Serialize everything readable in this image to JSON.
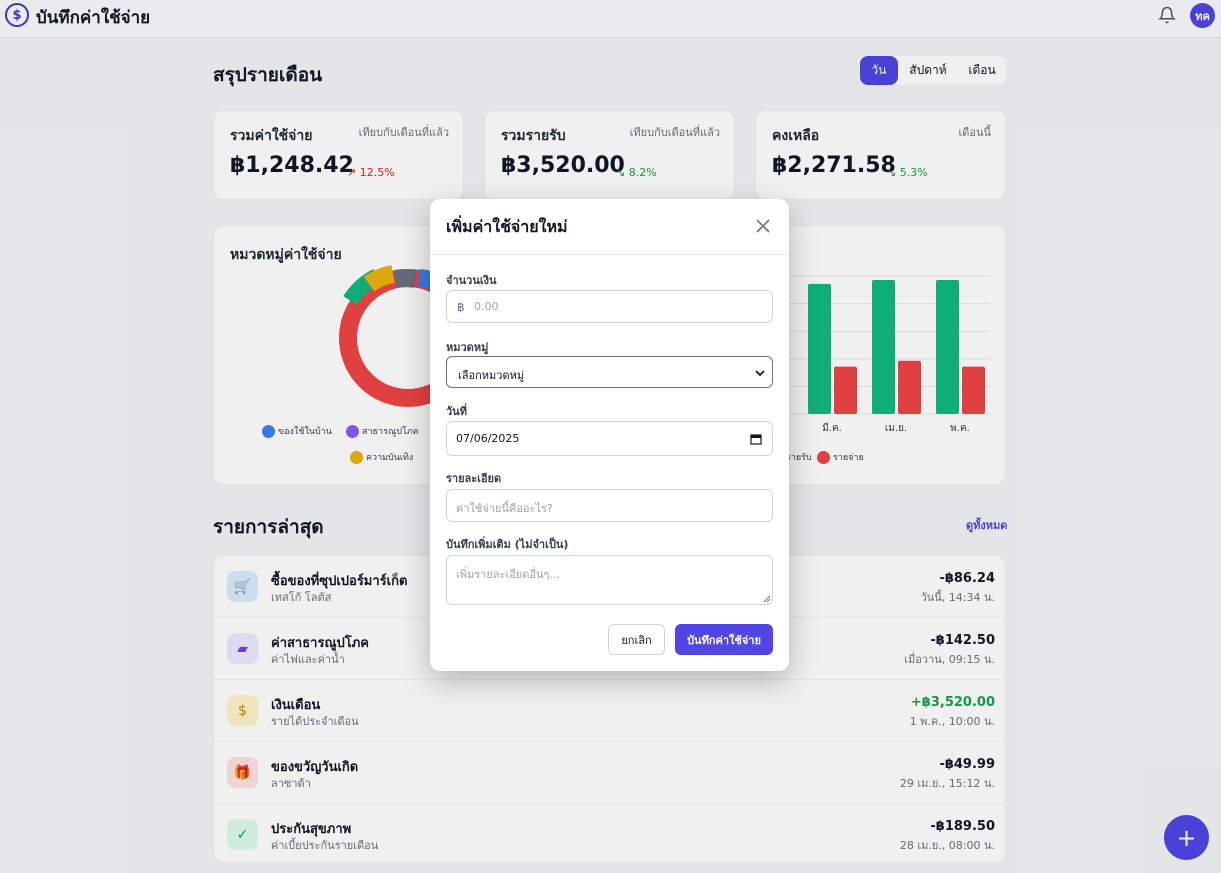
{
  "app": {
    "title": "บันทึกค่าใช้จ่าย",
    "avatar_initials": "ทค",
    "logo_glyph": "$"
  },
  "summary": {
    "title": "สรุปรายเดือน",
    "periods": [
      {
        "label": "วัน",
        "active": true
      },
      {
        "label": "สัปดาห์",
        "active": false
      },
      {
        "label": "เดือน",
        "active": false
      }
    ],
    "cards": [
      {
        "title": "รวมค่าใช้จ่าย",
        "sub": "เทียบกับเดือนที่แล้ว",
        "value": "฿1,248.42",
        "trend": "↗ 12.5%",
        "trend_dir": "up"
      },
      {
        "title": "รวมรายรับ",
        "sub": "เทียบกับเดือนที่แล้ว",
        "value": "฿3,520.00",
        "trend": "↘ 8.2%",
        "trend_dir": "down"
      },
      {
        "title": "คงเหลือ",
        "sub": "เดือนนี้",
        "value": "฿2,271.58",
        "trend": "↘ 5.3%",
        "trend_dir": "down"
      }
    ]
  },
  "category_panel": {
    "title": "หมวดหมู่ค่าใช้จ่าย",
    "legend": [
      {
        "label": "ของใช้ในบ้าน",
        "color": "#3b82f6"
      },
      {
        "label": "สาธารณูปโภค",
        "color": "#8b5cf6"
      },
      {
        "label": "ความบันเทิง",
        "color": "#eab308"
      }
    ]
  },
  "chart_data": {
    "type": "bar",
    "categories": [
      "มี.ค.",
      "เม.ย.",
      "พ.ค."
    ],
    "series": [
      {
        "name": "รายรับ",
        "color": "#10b981",
        "values": [
          3300,
          3400,
          3400
        ]
      },
      {
        "name": "รายจ่าย",
        "color": "#ef4444",
        "values": [
          1200,
          1350,
          1200
        ]
      }
    ],
    "ylim": [
      0,
      3500
    ],
    "grid": true,
    "legend_position": "bottom"
  },
  "recent": {
    "title": "รายการล่าสุด",
    "view_all": "ดูทั้งหมด",
    "items": [
      {
        "title": "ซื้อของที่ซุปเปอร์มาร์เก็ต",
        "sub": "เทสโก้ โลตัส",
        "amount": "-฿86.24",
        "time": "วันนี้, 14:34 น.",
        "type": "neg",
        "icon": "cart-icon",
        "glyph": "🛒",
        "bg": "#dbeafe",
        "fg": "#2563eb"
      },
      {
        "title": "ค่าสาธารณูปโภค",
        "sub": "ค่าไฟและค่าน้ำ",
        "amount": "-฿142.50",
        "time": "เมื่อวาน, 09:15 น.",
        "type": "neg",
        "icon": "utility-icon",
        "glyph": "▰",
        "bg": "#ede9fe",
        "fg": "#7c3aed"
      },
      {
        "title": "เงินเดือน",
        "sub": "รายได้ประจำเดือน",
        "amount": "+฿3,520.00",
        "time": "1 พ.ค., 10:00 น.",
        "type": "pos",
        "icon": "dollar-icon",
        "glyph": "$",
        "bg": "#fef3c7",
        "fg": "#ca8a04"
      },
      {
        "title": "ของขวัญวันเกิด",
        "sub": "ลาซาด้า",
        "amount": "-฿49.99",
        "time": "29 เม.ย., 15:12 น.",
        "type": "neg",
        "icon": "gift-icon",
        "glyph": "🎁",
        "bg": "#fee2e2",
        "fg": "#dc2626"
      },
      {
        "title": "ประกันสุขภาพ",
        "sub": "ค่าเบี้ยประกันรายเดือน",
        "amount": "-฿189.50",
        "time": "28 เม.ย., 08:00 น.",
        "type": "neg",
        "icon": "shield-icon",
        "glyph": "✓",
        "bg": "#dcfce7",
        "fg": "#16a34a"
      }
    ]
  },
  "fab": {
    "glyph": "+"
  },
  "modal": {
    "title": "เพิ่มค่าใช้จ่ายใหม่",
    "amount_label": "จำนวนเงิน",
    "amount_prefix": "฿",
    "amount_placeholder": "0.00",
    "category_label": "หมวดหมู่",
    "category_value": "เลือกหมวดหมู่",
    "date_label": "วันที่",
    "date_value": "07/06/2025",
    "desc_label": "รายละเอียด",
    "desc_placeholder": "ค่าใช้จ่ายนี้คืออะไร?",
    "note_label": "บันทึกเพิ่มเติม (ไม่จำเป็น)",
    "note_placeholder": "เพิ่มรายละเอียดอื่นๆ...",
    "cancel_label": "ยกเลิก",
    "save_label": "บันทึกค่าใช้จ่าย"
  }
}
